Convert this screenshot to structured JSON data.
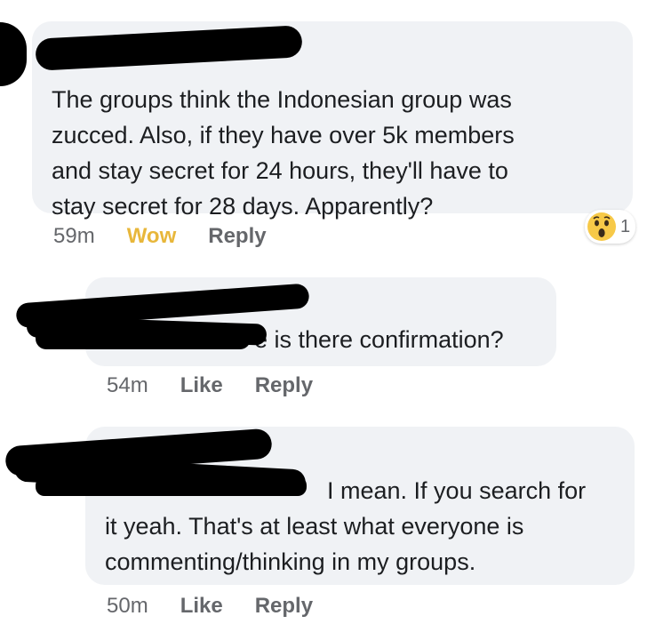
{
  "comments": [
    {
      "text": "The groups think the Indonesian group was\nzucced. Also, if they have over 5k members\nand stay secret for 24 hours, they'll have to\nstay secret for 28 days. Apparently?",
      "time": "59m",
      "reaction_label": "Wow",
      "reply_label": "Reply",
      "reaction": {
        "icon": "wow-emoji-icon",
        "count": "1"
      }
    },
    {
      "text": "e is there confirmation?",
      "time": "54m",
      "like_label": "Like",
      "reply_label": "Reply"
    },
    {
      "text": "I mean. If you search for\nit yeah. That's at least what everyone is\ncommenting/thinking in my groups.",
      "time": "50m",
      "like_label": "Like",
      "reply_label": "Reply"
    }
  ],
  "colors": {
    "bubble": "#f0f2f5",
    "wow": "#e8b73b",
    "meta": "#65676b",
    "redaction": "#000000"
  }
}
